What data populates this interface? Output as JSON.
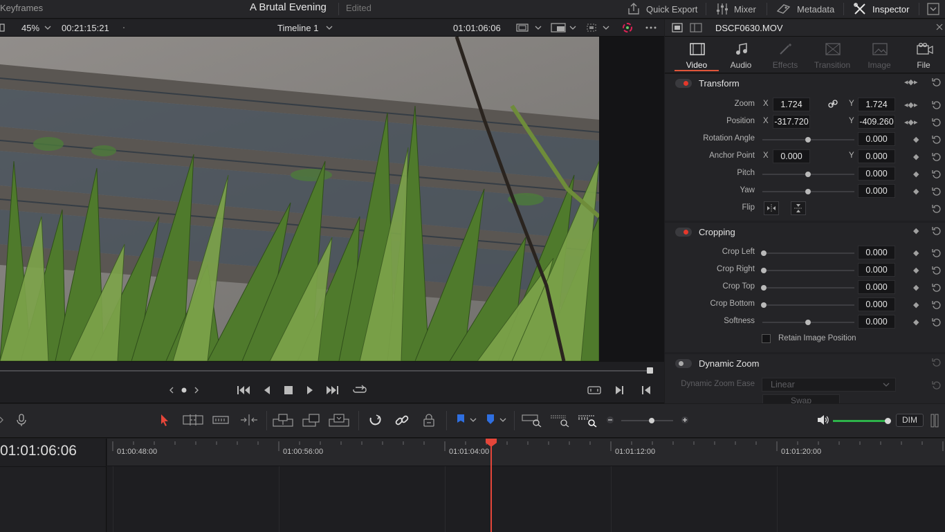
{
  "topbar": {
    "left_label": "Keyframes",
    "project_name": "A Brutal Evening",
    "project_status": "Edited",
    "buttons": [
      {
        "label": "Quick Export",
        "icon": "export-icon"
      },
      {
        "label": "Mixer",
        "icon": "mixer-icon"
      },
      {
        "label": "Metadata",
        "icon": "metadata-icon"
      },
      {
        "label": "Inspector",
        "icon": "inspector-icon",
        "active": true
      }
    ]
  },
  "viewer": {
    "zoom": "45%",
    "source_timecode": "00:21:15:21",
    "timeline_name": "Timeline 1",
    "record_timecode": "01:01:06:06"
  },
  "inspector": {
    "clip_name": "DSCF0630.MOV",
    "tabs": [
      {
        "label": "Video",
        "state": "active"
      },
      {
        "label": "Audio",
        "state": "normal"
      },
      {
        "label": "Effects",
        "state": "disabled"
      },
      {
        "label": "Transition",
        "state": "disabled"
      },
      {
        "label": "Image",
        "state": "disabled"
      },
      {
        "label": "File",
        "state": "normal"
      }
    ],
    "transform": {
      "title": "Transform",
      "zoom": {
        "label": "Zoom",
        "x_axis": "X",
        "x": "1.724",
        "y_axis": "Y",
        "y": "1.724"
      },
      "position": {
        "label": "Position",
        "x_axis": "X",
        "x": "-317.720",
        "y_axis": "Y",
        "y": "-409.260"
      },
      "rotation": {
        "label": "Rotation Angle",
        "value": "0.000",
        "level": 0.5
      },
      "anchor": {
        "label": "Anchor Point",
        "x_axis": "X",
        "x": "0.000",
        "y_axis": "Y",
        "y": "0.000"
      },
      "pitch": {
        "label": "Pitch",
        "value": "0.000",
        "level": 0.5
      },
      "yaw": {
        "label": "Yaw",
        "value": "0.000",
        "level": 0.5
      },
      "flip": {
        "label": "Flip"
      }
    },
    "cropping": {
      "title": "Cropping",
      "crop_left": {
        "label": "Crop Left",
        "value": "0.000",
        "level": 0.0
      },
      "crop_right": {
        "label": "Crop Right",
        "value": "0.000",
        "level": 0.0
      },
      "crop_top": {
        "label": "Crop Top",
        "value": "0.000",
        "level": 0.0
      },
      "crop_bottom": {
        "label": "Crop Bottom",
        "value": "0.000",
        "level": 0.0
      },
      "softness": {
        "label": "Softness",
        "value": "0.000",
        "level": 0.5
      },
      "retain": "Retain Image Position"
    },
    "dynamic_zoom": {
      "title": "Dynamic Zoom",
      "ease_label": "Dynamic Zoom Ease",
      "ease_value": "Linear",
      "swap_label": "Swap"
    }
  },
  "timeline": {
    "timecode": "01:01:06:06",
    "ruler_labels": [
      "01:00:48:00",
      "01:00:56:00",
      "01:01:04:00",
      "01:01:12:00",
      "01:01:20:00"
    ],
    "dim_label": "DIM"
  },
  "colors": {
    "accent_red": "#e5463a",
    "marker_blue": "#2f6fe0",
    "volume_green": "#2db34a"
  }
}
